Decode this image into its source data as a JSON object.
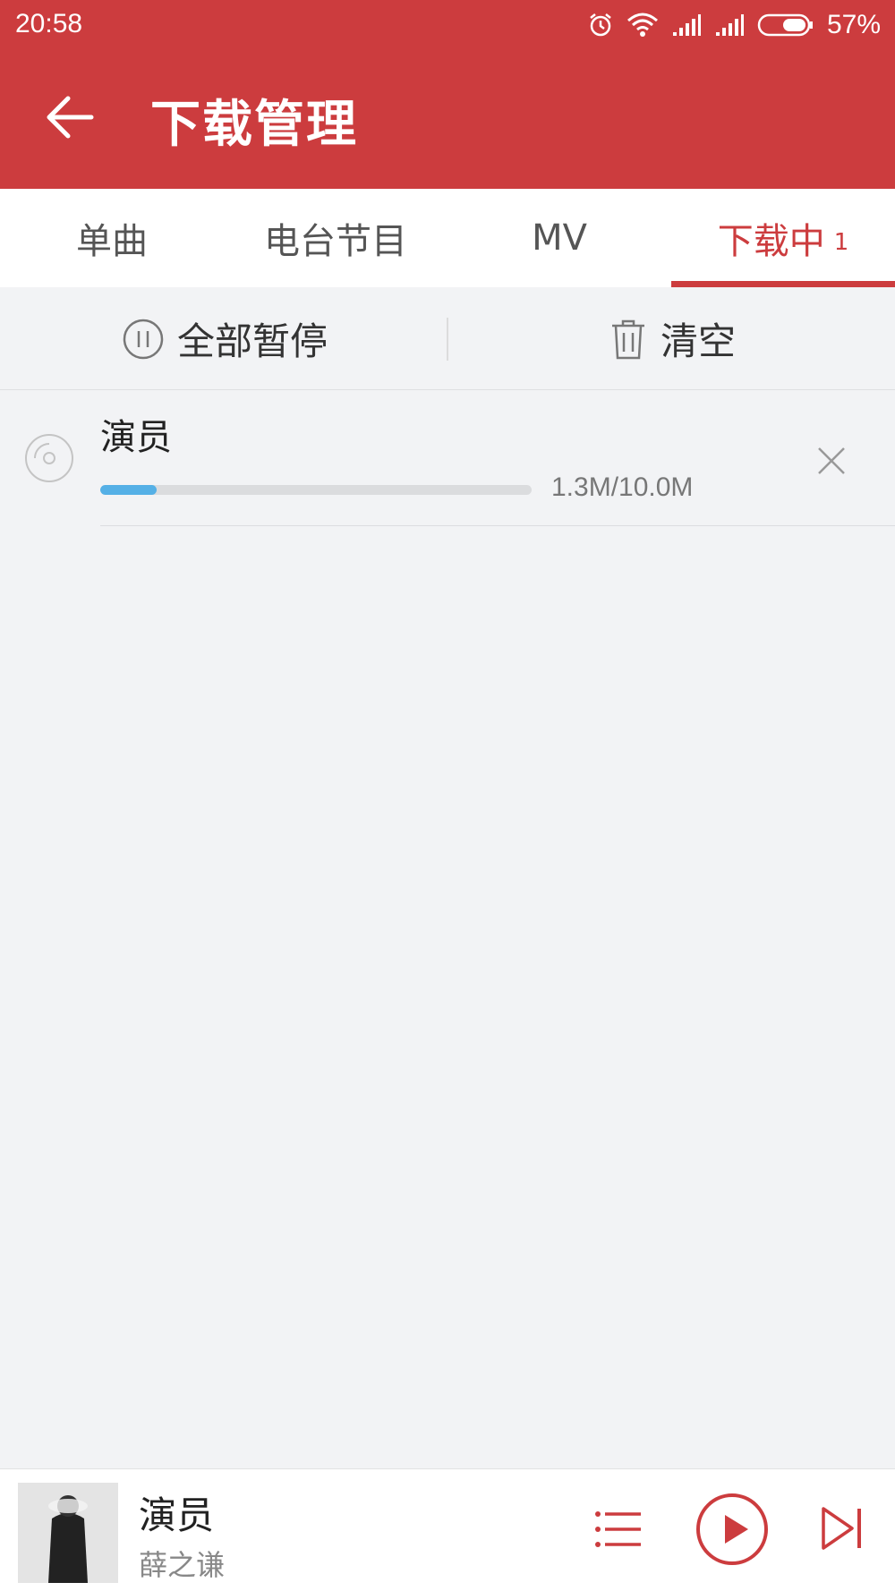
{
  "status_bar": {
    "time": "20:58",
    "battery_percent": "57%",
    "icons": [
      "alarm-icon",
      "wifi-icon",
      "signal-icon",
      "signal-icon",
      "battery-icon"
    ]
  },
  "header": {
    "title": "下载管理",
    "back_icon": "back-arrow-icon"
  },
  "tabs": [
    {
      "label": "单曲",
      "active": false
    },
    {
      "label": "电台节目",
      "active": false
    },
    {
      "label": "MV",
      "active": false
    },
    {
      "label": "下载中",
      "badge": "1",
      "active": true
    }
  ],
  "actions": {
    "pause_all_label": "全部暂停",
    "pause_icon": "pause-circle-icon",
    "clear_label": "清空",
    "clear_icon": "trash-icon"
  },
  "downloads": [
    {
      "title": "演员",
      "progress_text": "1.3M/10.0M",
      "progress_fraction": 0.13,
      "icon": "disc-icon",
      "remove_icon": "close-icon"
    }
  ],
  "mini_player": {
    "title": "演员",
    "artist": "薛之谦",
    "icons": [
      "playlist-icon",
      "play-icon",
      "next-icon"
    ]
  },
  "colors": {
    "primary": "#cc3c3e",
    "progress": "#55b0e6",
    "background": "#f2f3f5"
  }
}
